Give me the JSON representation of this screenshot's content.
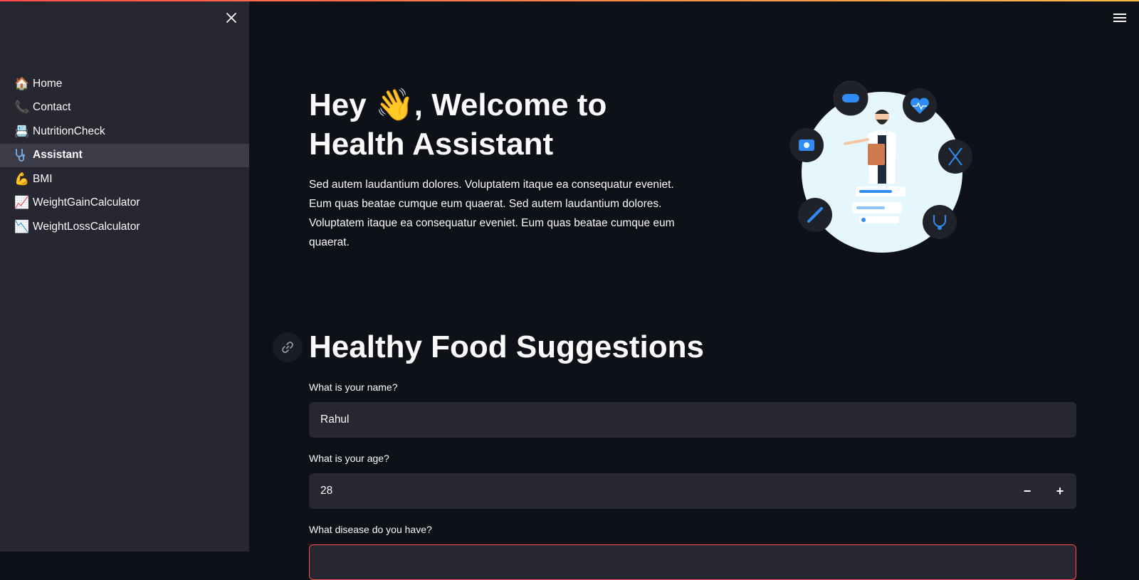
{
  "sidebar": {
    "close_icon": "close-icon",
    "items": [
      {
        "icon": "🏠",
        "label": "Home",
        "active": false
      },
      {
        "icon": "📞",
        "label": "Contact",
        "active": false
      },
      {
        "icon": "📇",
        "label": "NutritionCheck",
        "active": false
      },
      {
        "icon": "stethoscope-icon",
        "label": "Assistant",
        "active": true
      },
      {
        "icon": "💪",
        "label": "BMI",
        "active": false
      },
      {
        "icon": "📈",
        "label": "WeightGainCalculator",
        "active": false
      },
      {
        "icon": "📉",
        "label": "WeightLossCalculator",
        "active": false
      }
    ]
  },
  "header": {
    "menu_icon": "hamburger-menu-icon"
  },
  "hero": {
    "title_part1": "Hey ",
    "wave_emoji": "👋",
    "title_part2": ", Welcome to",
    "title_line2": "Health Assistant",
    "description": "Sed autem laudantium dolores. Voluptatem itaque ea consequatur eveniet. Eum quas beatae cumque eum quaerat. Sed autem laudantium dolores. Voluptatem itaque ea consequatur eveniet. Eum quas beatae cumque eum quaerat."
  },
  "section": {
    "title": "Healthy Food Suggestions",
    "anchor_icon": "link-icon"
  },
  "form": {
    "name_label": "What is your name?",
    "name_value": "Rahul",
    "age_label": "What is your age?",
    "age_value": "28",
    "age_decrement": "−",
    "age_increment": "+",
    "disease_label": "What disease do you have?",
    "disease_value": ""
  },
  "colors": {
    "background": "#0e1117",
    "sidebar": "#262730",
    "input": "#262730",
    "accent": "#ff4b4b",
    "illustration_bg": "#e6f6fd",
    "illustration_icon": "#2f8cf3"
  }
}
